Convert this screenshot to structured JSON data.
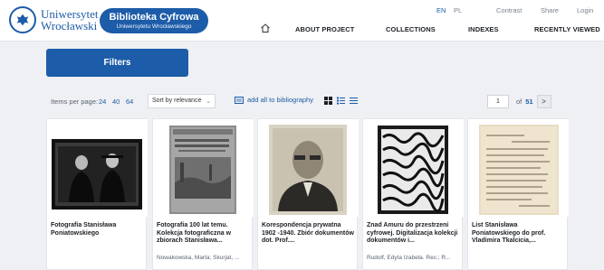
{
  "header": {
    "university_line1": "Uniwersytet",
    "university_line2": "Wrocławski",
    "library_title": "Biblioteka Cyfrowa",
    "library_subtitle": "Uniwersytetu Wrocławskiego",
    "lang_en": "EN",
    "lang_pl": "PL",
    "contrast": "Contrast",
    "share": "Share",
    "login": "Login"
  },
  "nav": {
    "home_icon": "home-icon",
    "items": [
      "ABOUT PROJECT",
      "COLLECTIONS",
      "INDEXES",
      "RECENTLY VIEWED"
    ]
  },
  "filters": {
    "label": "Filters"
  },
  "toolbar": {
    "items_per_page_label": "Items per page:",
    "per_page_options": [
      "24",
      "40",
      "64"
    ],
    "sort_value": "Sort by relevance",
    "add_all": "add all to bibliography",
    "current_page": "1",
    "of_label": "of",
    "total_pages": "51",
    "next_label": ">"
  },
  "cards": [
    {
      "title": "Fotografia Stanisława Poniatowskiego",
      "author": ""
    },
    {
      "title": "Fotografia 100 lat temu. Kolekcja fotograficzna w zbiorach Stanisława...",
      "author": "Nowakowska, Marta; Skurjat, ..."
    },
    {
      "title": "Korespondencja prywatna 1902 -1940. Zbiór dokumentów dot. Prof....",
      "author": ""
    },
    {
      "title": "Znad Amuru do przestrzeni cyfrowej. Digitalizacja kolekcji dokumentów i...",
      "author": "Rudolf, Edyta Izabela. Rec.; R..."
    },
    {
      "title": "List Stanisława Poniatowskiego do prof. Vladimira Tkalcicia,...",
      "author": ""
    }
  ],
  "colors": {
    "brand_blue": "#1d5ca8",
    "page_bg": "#eef0f3"
  }
}
